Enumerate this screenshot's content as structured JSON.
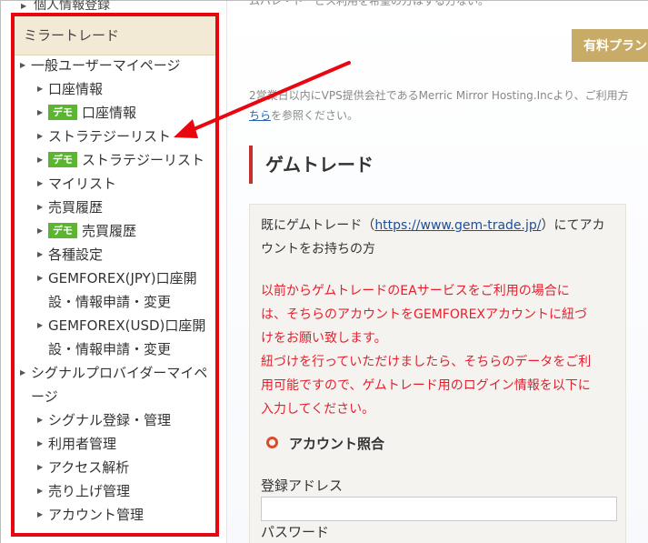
{
  "sidebar": {
    "prev_item": "個人情報登録",
    "header": "ミラートレード",
    "items": [
      {
        "level": 1,
        "label": "一般ユーザーマイページ",
        "demo": false
      },
      {
        "level": 2,
        "label": "口座情報",
        "demo": false
      },
      {
        "level": 2,
        "label": "口座情報",
        "demo": true
      },
      {
        "level": 2,
        "label": "ストラテジーリスト",
        "demo": false
      },
      {
        "level": 2,
        "label": "ストラテジーリスト",
        "demo": true
      },
      {
        "level": 2,
        "label": "マイリスト",
        "demo": false
      },
      {
        "level": 2,
        "label": "売買履歴",
        "demo": false
      },
      {
        "level": 2,
        "label": "売買履歴",
        "demo": true
      },
      {
        "level": 2,
        "label": "各種設定",
        "demo": false
      },
      {
        "level": 2,
        "label": "GEMFOREX(JPY)口座開",
        "label2": "設・情報申請・変更",
        "demo": false
      },
      {
        "level": 2,
        "label": "GEMFOREX(USD)口座開",
        "label2": "設・情報申請・変更",
        "demo": false
      },
      {
        "level": 1,
        "label": "シグナルプロバイダーマイペ",
        "label2": "ージ",
        "demo": false
      },
      {
        "level": 2,
        "label": "シグナル登録・管理",
        "demo": false
      },
      {
        "level": 2,
        "label": "利用者管理",
        "demo": false
      },
      {
        "level": 2,
        "label": "アクセス解析",
        "demo": false
      },
      {
        "level": 2,
        "label": "売り上げ管理",
        "demo": false
      },
      {
        "level": 2,
        "label": "アカウント管理",
        "demo": false
      }
    ],
    "demo_badge": "デモ"
  },
  "main": {
    "top_text": "ムバレ・ドービス利用を希望の方はする方ない。",
    "plan_button": "有料プラン",
    "info_line1": "2営業日以内にVPS提供会社であるMerric Mirror Hosting.Incより、ご利用方",
    "info_link": "ちら",
    "info_line2_rest": "を参照ください。",
    "heading": "ゲムトレード",
    "card": {
      "p1_prefix": "既にゲムトレード（",
      "p1_url": "https://www.gem-trade.jp/",
      "p1_suffix": "）にてアカ",
      "p1_line2": "ウントをお持ちの方",
      "p2_lines": [
        "以前からゲムトレードのEAサービスをご利用の場合に",
        "は、そちらのアカウントをGEMFOREXアカウントに紐づ",
        "けをお願い致します。",
        "紐づけを行っていただけましたら、そちらのデータをご利",
        "用可能ですので、ゲムトレード用のログイン情報を以下に",
        "入力してください。"
      ],
      "section_title": "アカウント照合",
      "email_label": "登録アドレス",
      "email_value": "",
      "password_label": "パスワード"
    }
  },
  "colors": {
    "highlight_box": "#e8060f",
    "arrow": "#e8060f",
    "demo_badge": "#5cb531",
    "plan_button": "#c9ab68",
    "notice_text": "#e5202e"
  }
}
